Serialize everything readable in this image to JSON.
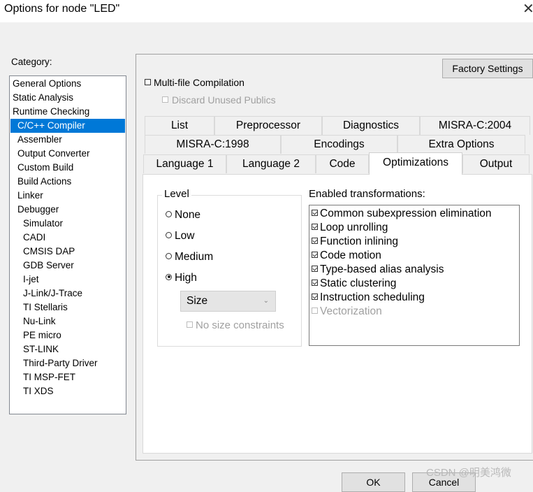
{
  "window": {
    "title": "Options for node \"LED\""
  },
  "category": {
    "label": "Category:",
    "items": [
      {
        "label": "General Options",
        "indent": 0
      },
      {
        "label": "Static Analysis",
        "indent": 0
      },
      {
        "label": "Runtime Checking",
        "indent": 0
      },
      {
        "label": "C/C++ Compiler",
        "indent": 1,
        "selected": true
      },
      {
        "label": "Assembler",
        "indent": 1
      },
      {
        "label": "Output Converter",
        "indent": 1
      },
      {
        "label": "Custom Build",
        "indent": 1
      },
      {
        "label": "Build Actions",
        "indent": 1
      },
      {
        "label": "Linker",
        "indent": 1
      },
      {
        "label": "Debugger",
        "indent": 1
      },
      {
        "label": "Simulator",
        "indent": 2
      },
      {
        "label": "CADI",
        "indent": 2
      },
      {
        "label": "CMSIS DAP",
        "indent": 2
      },
      {
        "label": "GDB Server",
        "indent": 2
      },
      {
        "label": "I-jet",
        "indent": 2
      },
      {
        "label": "J-Link/J-Trace",
        "indent": 2
      },
      {
        "label": "TI Stellaris",
        "indent": 2
      },
      {
        "label": "Nu-Link",
        "indent": 2
      },
      {
        "label": "PE micro",
        "indent": 2
      },
      {
        "label": "ST-LINK",
        "indent": 2
      },
      {
        "label": "Third-Party Driver",
        "indent": 2
      },
      {
        "label": "TI MSP-FET",
        "indent": 2
      },
      {
        "label": "TI XDS",
        "indent": 2
      }
    ]
  },
  "panel": {
    "factory_settings": "Factory Settings",
    "multi_file": "Multi-file Compilation",
    "discard_unused": "Discard Unused Publics"
  },
  "tabs": {
    "row1": [
      "List",
      "Preprocessor",
      "Diagnostics",
      "MISRA-C:2004"
    ],
    "row2": [
      "MISRA-C:1998",
      "Encodings",
      "Extra Options"
    ],
    "row3": [
      "Language 1",
      "Language 2",
      "Code",
      "Optimizations",
      "Output"
    ],
    "active": "Optimizations"
  },
  "level": {
    "title": "Level",
    "options": [
      "None",
      "Low",
      "Medium",
      "High"
    ],
    "selected": "High",
    "size_select": "Size",
    "no_size_constraints": "No size constraints"
  },
  "transformations": {
    "title": "Enabled transformations:",
    "items": [
      {
        "label": "Common subexpression elimination",
        "checked": true,
        "enabled": true
      },
      {
        "label": "Loop unrolling",
        "checked": true,
        "enabled": true
      },
      {
        "label": "Function inlining",
        "checked": true,
        "enabled": true
      },
      {
        "label": "Code motion",
        "checked": true,
        "enabled": true
      },
      {
        "label": "Type-based alias analysis",
        "checked": true,
        "enabled": true
      },
      {
        "label": "Static clustering",
        "checked": true,
        "enabled": true
      },
      {
        "label": "Instruction scheduling",
        "checked": true,
        "enabled": true
      },
      {
        "label": "Vectorization",
        "checked": false,
        "enabled": false
      }
    ]
  },
  "footer": {
    "ok": "OK",
    "cancel": "Cancel"
  },
  "watermark": "CSDN @明美鸿微",
  "colors": {
    "selection": "#0078d7"
  }
}
